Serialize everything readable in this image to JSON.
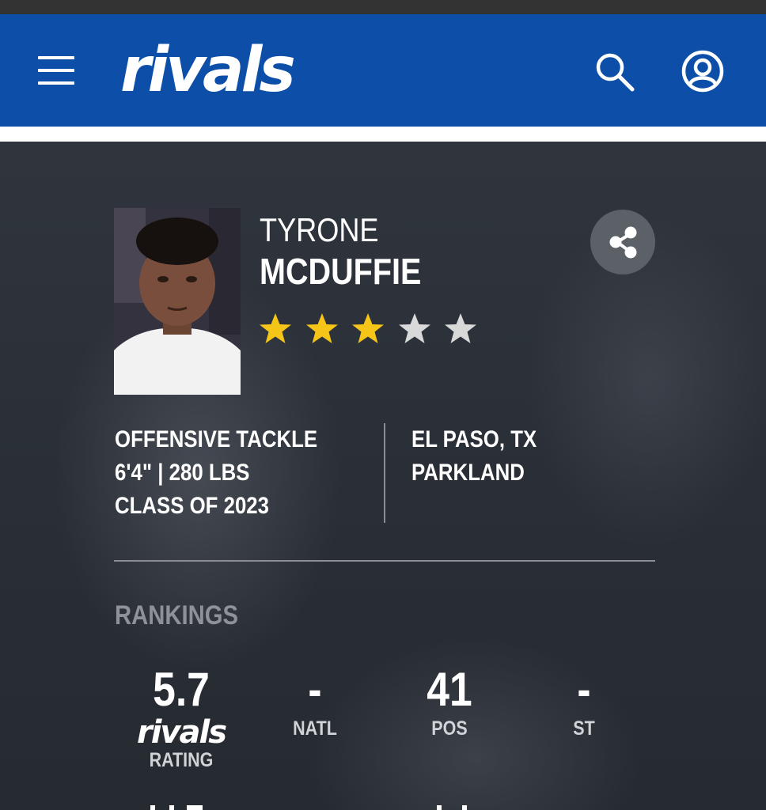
{
  "header": {
    "logo_text": "rivals",
    "menu_icon": "hamburger-menu-icon",
    "search_icon": "search-icon",
    "account_icon": "account-icon",
    "brand_color": "#0d4fa8"
  },
  "player": {
    "first_name": "TYRONE",
    "last_name": "MCDUFFIE",
    "star_rating": 3,
    "star_max": 5,
    "position": "OFFENSIVE TACKLE",
    "size": "6'4\" | 280 LBS",
    "class": "CLASS OF 2023",
    "hometown": "EL PASO, TX",
    "school": "PARKLAND",
    "share_icon": "share-icon"
  },
  "rankings": {
    "title": "RANKINGS",
    "rating_value": "5.7",
    "rating_logo": "rivals",
    "rating_label": "RATING",
    "natl_value": "-",
    "natl_label": "NATL",
    "pos_value": "41",
    "pos_label": "POS",
    "st_value": "-",
    "st_label": "ST"
  },
  "colors": {
    "star_filled": "#f5c518",
    "star_empty": "#d9d9d9"
  }
}
